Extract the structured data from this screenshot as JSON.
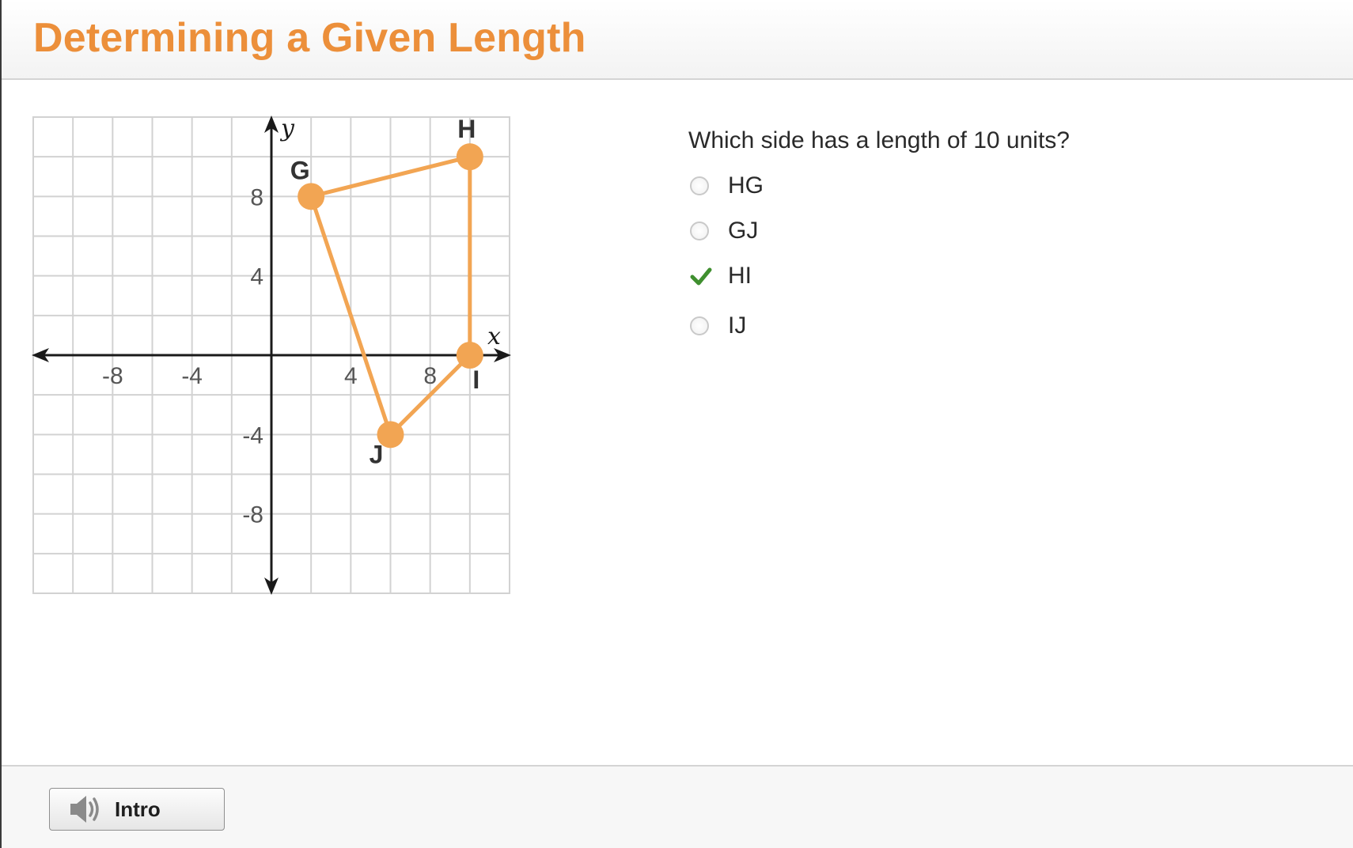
{
  "header": {
    "title": "Determining a Given Length"
  },
  "graph": {
    "x_axis_label": "x",
    "y_axis_label": "y",
    "x_tick_labels": [
      "-8",
      "-4",
      "4",
      "8"
    ],
    "y_tick_labels": [
      "8",
      "4",
      "-4",
      "-8"
    ],
    "x_range": [
      -12,
      12
    ],
    "y_range": [
      -12,
      12
    ],
    "grid_step": 2,
    "polygon_color": "#f2a553",
    "points": [
      {
        "name": "G",
        "x": 2,
        "y": 8
      },
      {
        "name": "H",
        "x": 10,
        "y": 10
      },
      {
        "name": "I",
        "x": 10,
        "y": 0
      },
      {
        "name": "J",
        "x": 6,
        "y": -4
      }
    ]
  },
  "question": {
    "prompt": "Which side has a length of 10 units?",
    "options": [
      {
        "label": "HG",
        "state": "unselected"
      },
      {
        "label": "GJ",
        "state": "unselected"
      },
      {
        "label": "HI",
        "state": "correct"
      },
      {
        "label": "IJ",
        "state": "unselected"
      }
    ],
    "correct_color": "#3f8f2f"
  },
  "footer": {
    "intro_label": "Intro",
    "intro_icon": "speaker-icon"
  }
}
